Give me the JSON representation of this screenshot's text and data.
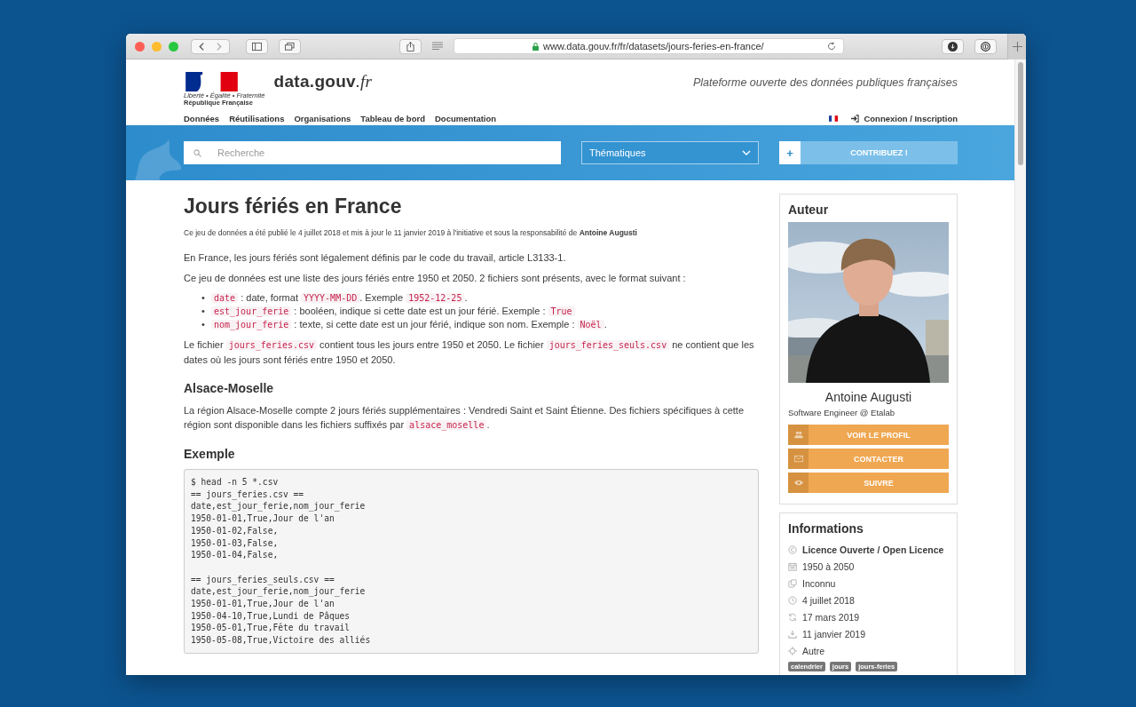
{
  "browser": {
    "url": "www.data.gouv.fr/fr/datasets/jours-feries-en-france/"
  },
  "header": {
    "logo_motto": "Liberté • Égalité • Fraternité",
    "logo_name": "République Française",
    "site_name": "data.gouv",
    "site_suffix": ".fr",
    "tagline": "Plateforme ouverte des données publiques françaises"
  },
  "nav": {
    "items": [
      "Données",
      "Réutilisations",
      "Organisations",
      "Tableau de bord",
      "Documentation"
    ],
    "login": "Connexion / Inscription"
  },
  "search": {
    "placeholder": "Recherche"
  },
  "themes_select": {
    "value": "Thématiques"
  },
  "contribute": {
    "icon": "+",
    "label": "CONTRIBUEZ !"
  },
  "dataset": {
    "title": "Jours fériés en France",
    "meta": "Ce jeu de données a été publié le 4 juillet 2018 et mis à jour le 11 janvier 2019 à l'initiative et sous la responsabilité de **Antoine Augusti**",
    "blocks": [
      {
        "kind": "paragraph",
        "segments": [
          {
            "text": "En France, les jours fériés sont légalement définis par le code du travail, article L3133-1.",
            "code": false
          }
        ]
      },
      {
        "kind": "paragraph",
        "segments": [
          {
            "text": "Ce jeu de données est une liste des jours fériés entre 1950 et 2050. 2 fichiers sont présents, avec le format suivant :",
            "code": false
          }
        ]
      },
      {
        "kind": "list",
        "bullet": "•",
        "items": [
          [
            {
              "text": "date",
              "code": true
            },
            {
              "text": " : date, format ",
              "code": false
            },
            {
              "text": "YYYY-MM-DD",
              "code": true
            },
            {
              "text": ". Exemple ",
              "code": false
            },
            {
              "text": "1952-12-25",
              "code": true
            },
            {
              "text": ".",
              "code": false
            }
          ],
          [
            {
              "text": "est_jour_ferie",
              "code": true
            },
            {
              "text": " : booléen, indique si cette date est un jour férié. Exemple : ",
              "code": false
            },
            {
              "text": "True",
              "code": true
            }
          ],
          [
            {
              "text": "nom_jour_ferie",
              "code": true
            },
            {
              "text": " : texte, si cette date est un jour férié, indique son nom. Exemple : ",
              "code": false
            },
            {
              "text": "Noël",
              "code": true
            },
            {
              "text": ".",
              "code": false
            }
          ]
        ]
      },
      {
        "kind": "paragraph",
        "segments": [
          {
            "text": "Le fichier ",
            "code": false
          },
          {
            "text": "jours_feries.csv",
            "code": true
          },
          {
            "text": " contient tous les jours entre 1950 et 2050. Le fichier ",
            "code": false
          },
          {
            "text": "jours_feries_seuls.csv",
            "code": true
          },
          {
            "text": " ne contient que les dates où les jours sont fériés entre 1950 et 2050.",
            "code": false
          }
        ]
      },
      {
        "kind": "heading",
        "text": "Alsace-Moselle"
      },
      {
        "kind": "paragraph",
        "segments": [
          {
            "text": "La région Alsace-Moselle compte 2 jours fériés supplémentaires : Vendredi Saint et Saint Étienne. Des fichiers spécifiques à cette région sont disponible dans les fichiers suffixés par ",
            "code": false
          },
          {
            "text": "alsace_moselle",
            "code": true
          },
          {
            "text": ".",
            "code": false
          }
        ]
      },
      {
        "kind": "heading",
        "text": "Exemple"
      },
      {
        "kind": "code",
        "groups": [
          [
            "$ head -n 5 *.csv",
            "== jours_feries.csv ==",
            "date,est_jour_ferie,nom_jour_ferie",
            "1950-01-01,True,Jour de l'an",
            "1950-01-02,False,",
            "1950-01-03,False,",
            "1950-01-04,False,"
          ],
          [
            "== jours_feries_seuls.csv ==",
            "date,est_jour_ferie,nom_jour_ferie",
            "1950-01-01,True,Jour de l'an",
            "1950-04-10,True,Lundi de Pâques",
            "1950-05-01,True,Fête du travail",
            "1950-05-08,True,Victoire des alliés"
          ]
        ]
      }
    ]
  },
  "author": {
    "heading": "Auteur",
    "name": "Antoine Augusti",
    "role": "Software Engineer @ Etalab",
    "buttons": [
      {
        "kind": "profile",
        "label": "VOIR LE PROFIL"
      },
      {
        "kind": "contact",
        "label": "CONTACTER"
      },
      {
        "kind": "follow",
        "label": "SUIVRE"
      }
    ]
  },
  "informations": {
    "heading": "Informations",
    "items": [
      {
        "kind": "license",
        "text": "Licence Ouverte / Open Licence",
        "bold": true
      },
      {
        "kind": "calendar",
        "text": "1950 à 2050",
        "bold": false
      },
      {
        "kind": "frequency",
        "text": "Inconnu",
        "bold": false
      },
      {
        "kind": "created",
        "text": "4 juillet 2018",
        "bold": false
      },
      {
        "kind": "modified",
        "text": "17 mars 2019",
        "bold": false
      },
      {
        "kind": "updated",
        "text": "11 janvier 2019",
        "bold": false
      },
      {
        "kind": "spatial",
        "text": "Autre",
        "bold": false
      }
    ],
    "tags": [
      "calendrier",
      "jours",
      "jours-feries"
    ]
  }
}
